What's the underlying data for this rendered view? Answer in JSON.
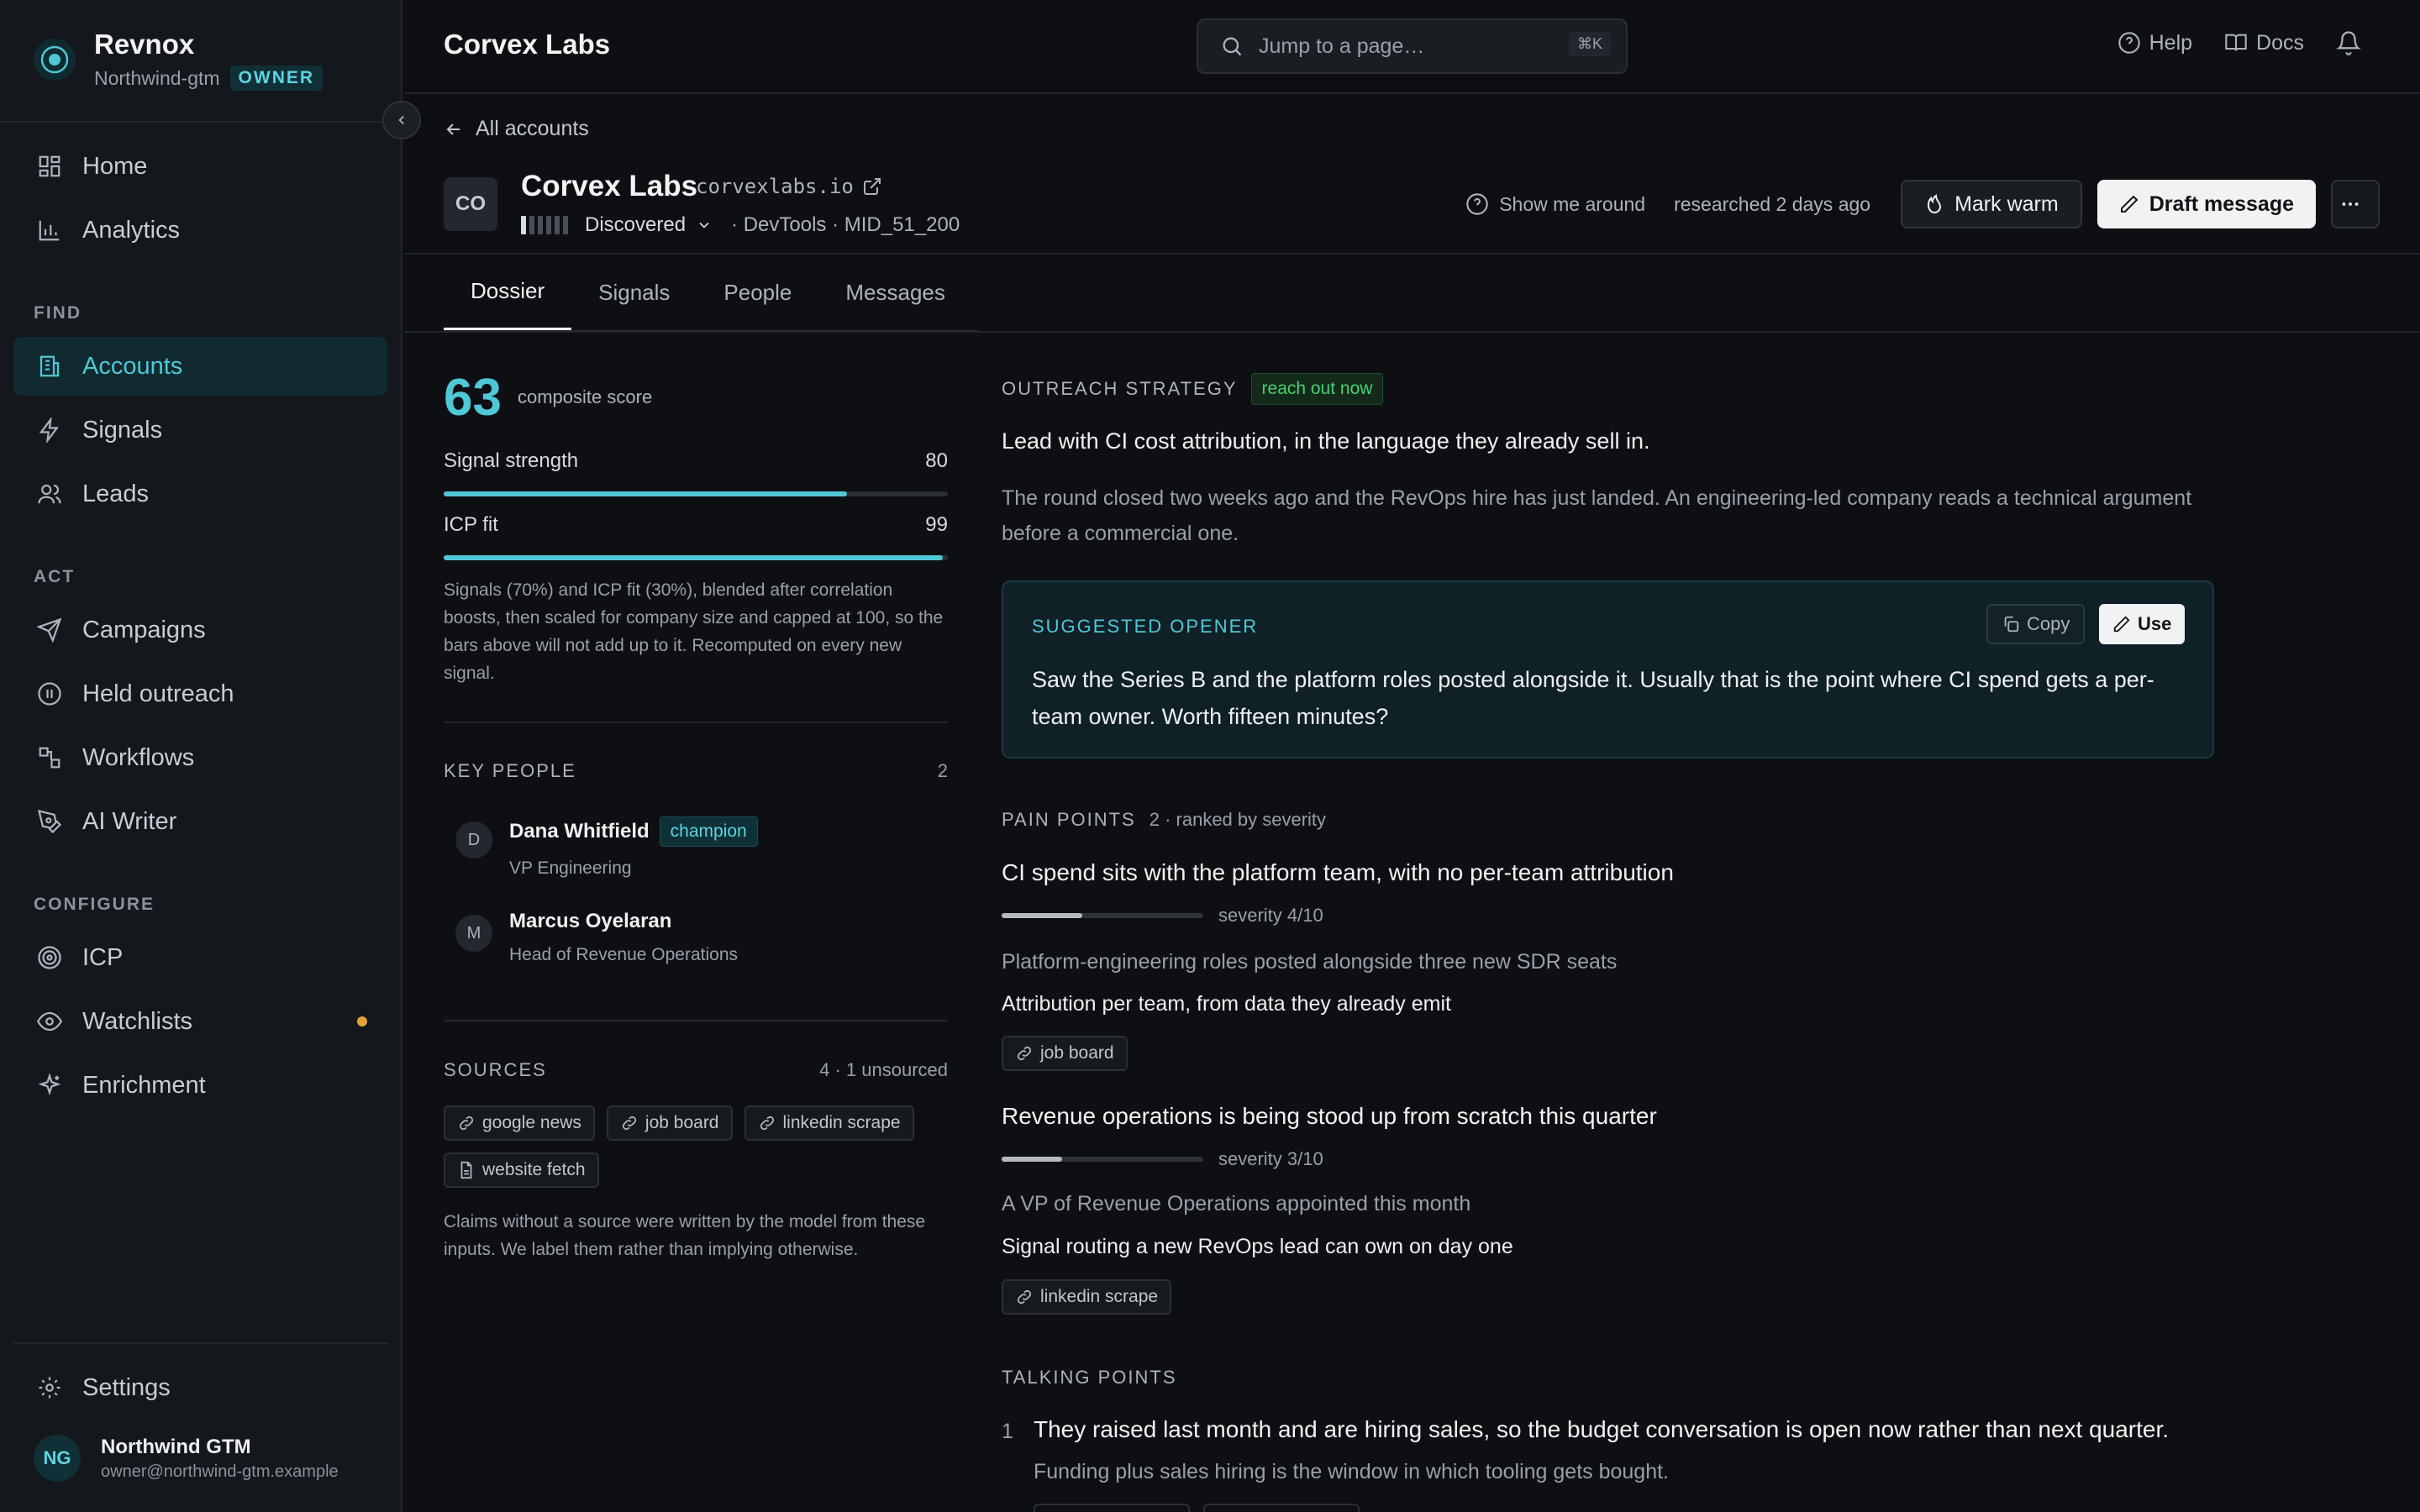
{
  "brand": {
    "name": "Revnox",
    "workspace": "Northwind-gtm",
    "role": "OWNER"
  },
  "sidebar": {
    "items": [
      {
        "label": "Home",
        "icon": "grid-icon"
      },
      {
        "label": "Analytics",
        "icon": "bar-chart-icon"
      }
    ],
    "sections": [
      {
        "title": "FIND",
        "items": [
          {
            "label": "Accounts",
            "icon": "building-icon",
            "active": true
          },
          {
            "label": "Signals",
            "icon": "bolt-icon"
          },
          {
            "label": "Leads",
            "icon": "users-icon"
          }
        ]
      },
      {
        "title": "ACT",
        "items": [
          {
            "label": "Campaigns",
            "icon": "send-icon"
          },
          {
            "label": "Held outreach",
            "icon": "pause-icon"
          },
          {
            "label": "Workflows",
            "icon": "workflow-icon"
          },
          {
            "label": "AI Writer",
            "icon": "pen-icon"
          }
        ]
      },
      {
        "title": "CONFIGURE",
        "items": [
          {
            "label": "ICP",
            "icon": "target-icon"
          },
          {
            "label": "Watchlists",
            "icon": "eye-icon",
            "indicator": true
          },
          {
            "label": "Enrichment",
            "icon": "sparkle-icon"
          }
        ]
      }
    ],
    "settings": "Settings",
    "user": {
      "initials": "NG",
      "name": "Northwind GTM",
      "email": "owner@northwind-gtm.example"
    }
  },
  "header": {
    "title": "Corvex Labs",
    "search_placeholder": "Jump to a page…",
    "shortcut": "⌘K",
    "help": "Help",
    "docs": "Docs"
  },
  "account": {
    "back": "All accounts",
    "initials": "CO",
    "name": "Corvex Labs",
    "domain": "corvexlabs.io",
    "stage": "Discovered",
    "stage_level": 1,
    "stage_total": 6,
    "meta": "· DevTools · MID_51_200",
    "show_me_around": "Show me around",
    "researched": "researched 2 days ago",
    "mark_warm": "Mark warm",
    "draft_message": "Draft message"
  },
  "tabs": [
    "Dossier",
    "Signals",
    "People",
    "Messages"
  ],
  "scores": {
    "composite": "63",
    "composite_label": "composite score",
    "signal_label": "Signal strength",
    "signal_value": "80",
    "signal_pct": 80,
    "icp_label": "ICP fit",
    "icp_value": "99",
    "icp_pct": 99,
    "note": "Signals (70%) and ICP fit (30%), blended after correlation boosts, then scaled for company size and capped at 100, so the bars above will not add up to it. Recomputed on every new signal."
  },
  "key_people": {
    "title": "KEY PEOPLE",
    "count": "2",
    "people": [
      {
        "initial": "D",
        "name": "Dana Whitfield",
        "badge": "champion",
        "role": "VP Engineering"
      },
      {
        "initial": "M",
        "name": "Marcus Oyelaran",
        "badge": "",
        "role": "Head of Revenue Operations"
      }
    ]
  },
  "sources": {
    "title": "SOURCES",
    "count": "4 · 1 unsourced",
    "chips": [
      "google news",
      "job board",
      "linkedin scrape",
      "website fetch"
    ],
    "note": "Claims without a source were written by the model from these inputs. We label them rather than implying otherwise."
  },
  "strategy": {
    "title": "OUTREACH STRATEGY",
    "tag": "reach out now",
    "lead": "Lead with CI cost attribution, in the language they already sell in.",
    "body": "The round closed two weeks ago and the RevOps hire has just landed. An engineering-led company reads a technical argument before a commercial one.",
    "opener_label": "SUGGESTED OPENER",
    "opener_copy": "Copy",
    "opener_use": "Use",
    "opener_text": "Saw the Series B and the platform roles posted alongside it. Usually that is the point where CI spend gets a per-team owner. Worth fifteen minutes?"
  },
  "pain_points": {
    "title": "PAIN POINTS",
    "subtitle": "2 · ranked by severity",
    "items": [
      {
        "title": "CI spend sits with the platform team, with no per-team attribution",
        "severity": "severity 4/10",
        "severity_value": 4,
        "evidence": "Platform-engineering roles posted alongside three new SDR seats",
        "solution": "Attribution per team, from data they already emit",
        "source": "job board"
      },
      {
        "title": "Revenue operations is being stood up from scratch this quarter",
        "severity": "severity 3/10",
        "severity_value": 3,
        "evidence": "A VP of Revenue Operations appointed this month",
        "solution": "Signal routing a new RevOps lead can own on day one",
        "source": "linkedin scrape"
      }
    ]
  },
  "talking_points": {
    "title": "TALKING POINTS",
    "items": [
      {
        "num": "1",
        "text": "They raised last month and are hiring sales, so the budget conversation is open now rather than next quarter.",
        "sub": "Funding plus sales hiring is the window in which tooling gets bought."
      }
    ]
  },
  "colors": {
    "accent": "#4fc7d6",
    "background": "#0d0f12",
    "sidebar": "#14171b",
    "tag_green": "#4ccf6f",
    "indicator": "#e0a43a"
  }
}
